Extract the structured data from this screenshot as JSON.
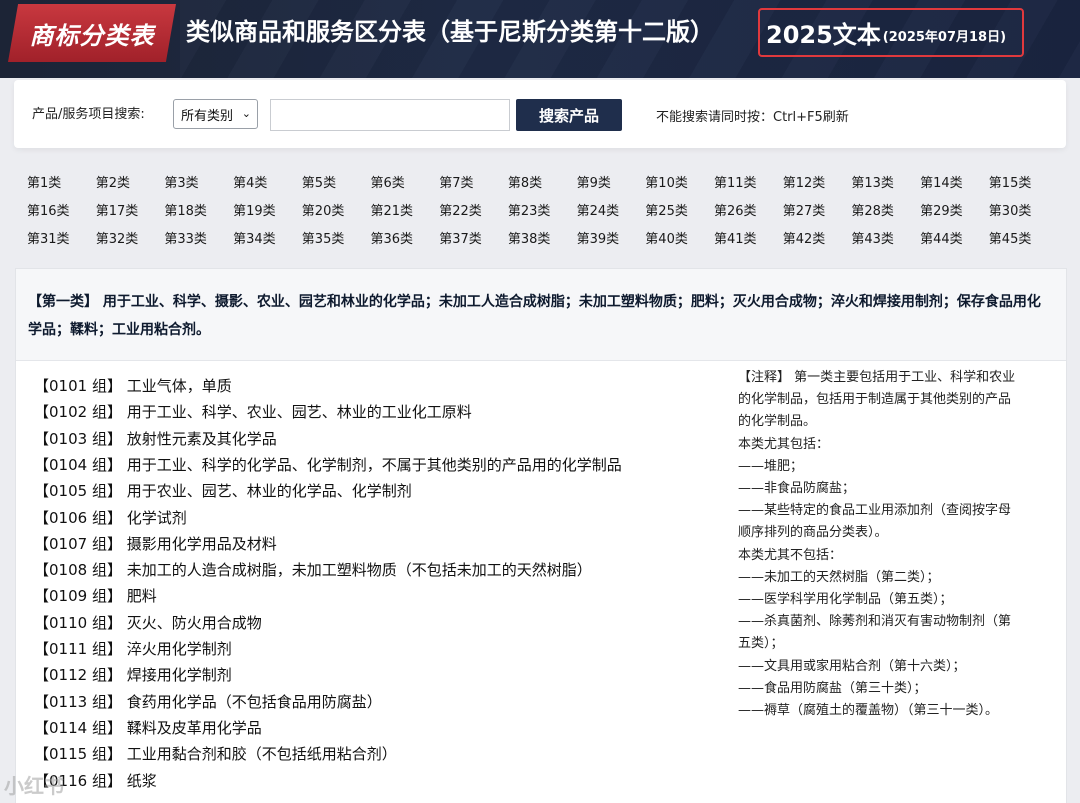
{
  "header": {
    "brand": "商标分类表",
    "title": "类似商品和服务区分表（基于尼斯分类第十二版）",
    "edition_main": "2025文本",
    "edition_date": "(2025年07月18日)"
  },
  "search": {
    "label": "产品/服务项目搜索:",
    "select_value": "所有类别",
    "input_value": "",
    "button": "搜索产品",
    "hint": "不能搜索请同时按：Ctrl+F5刷新"
  },
  "classes": [
    "第1类",
    "第2类",
    "第3类",
    "第4类",
    "第5类",
    "第6类",
    "第7类",
    "第8类",
    "第9类",
    "第10类",
    "第11类",
    "第12类",
    "第13类",
    "第14类",
    "第15类",
    "第16类",
    "第17类",
    "第18类",
    "第19类",
    "第20类",
    "第21类",
    "第22类",
    "第23类",
    "第24类",
    "第25类",
    "第26类",
    "第27类",
    "第28类",
    "第29类",
    "第30类",
    "第31类",
    "第32类",
    "第33类",
    "第34类",
    "第35类",
    "第36类",
    "第37类",
    "第38类",
    "第39类",
    "第40类",
    "第41类",
    "第42类",
    "第43类",
    "第44类",
    "第45类"
  ],
  "panel": {
    "heading": "【第一类】 用于工业、科学、摄影、农业、园艺和林业的化学品；未加工人造合成树脂；未加工塑料物质；肥料；灭火用合成物；淬火和焊接用制剂；保存食品用化学品；鞣料；工业用粘合剂。",
    "groups": [
      "【0101 组】 工业气体，单质",
      "【0102 组】 用于工业、科学、农业、园艺、林业的工业化工原料",
      "【0103 组】 放射性元素及其化学品",
      "【0104 组】 用于工业、科学的化学品、化学制剂，不属于其他类别的产品用的化学制品",
      "【0105 组】 用于农业、园艺、林业的化学品、化学制剂",
      "【0106 组】 化学试剂",
      "【0107 组】  摄影用化学用品及材料",
      "【0108 组】 未加工的人造合成树脂，未加工塑料物质（不包括未加工的天然树脂）",
      "【0109 组】 肥料",
      "【0110 组】 灭火、防火用合成物",
      "【0111 组】 淬火用化学制剂",
      "【0112 组】 焊接用化学制剂",
      "【0113 组】 食药用化学品（不包括食品用防腐盐）",
      "【0114 组】 鞣料及皮革用化学品",
      "【0115 组】 工业用黏合剂和胶（不包括纸用粘合剂）",
      "【0116 组】 纸浆"
    ],
    "notes": [
      "【注释】 第一类主要包括用于工业、科学和农业",
      "的化学制品，包括用于制造属于其他类别的产品",
      "的化学制品。",
      "本类尤其包括：",
      "——堆肥；",
      "——非食品防腐盐；",
      "——某些特定的食品工业用添加剂（查阅按字母",
      "顺序排列的商品分类表）。",
      "本类尤其不包括：",
      "——未加工的天然树脂（第二类）；",
      "——医学科学用化学制品（第五类）；",
      "——杀真菌剂、除莠剂和消灭有害动物制剂（第",
      "五类）；",
      "——文具用或家用粘合剂（第十六类）；",
      "——食品用防腐盐（第三十类）；",
      "——褥草（腐殖土的覆盖物）（第三十一类）。"
    ]
  },
  "watermark": "小红书"
}
